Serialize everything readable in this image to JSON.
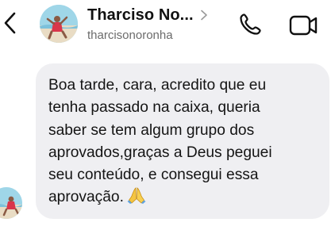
{
  "header": {
    "back_icon": "chevron-left-icon",
    "contact_name": "Tharciso No...",
    "contact_handle": "tharcisonoronha",
    "call_icon": "phone-icon",
    "video_icon": "video-camera-icon"
  },
  "message": {
    "text": "Boa tarde, cara, acredito que eu\ntenha passado na caixa, queria\nsaber se tem algum grupo dos\naprovados,graças a Deus peguei\nseu conteúdo, e consegui essa\naprovação.",
    "emoji": "🙏"
  },
  "colors": {
    "bubble": "#efeff2",
    "text": "#141414",
    "handle": "#6b6b6b"
  }
}
